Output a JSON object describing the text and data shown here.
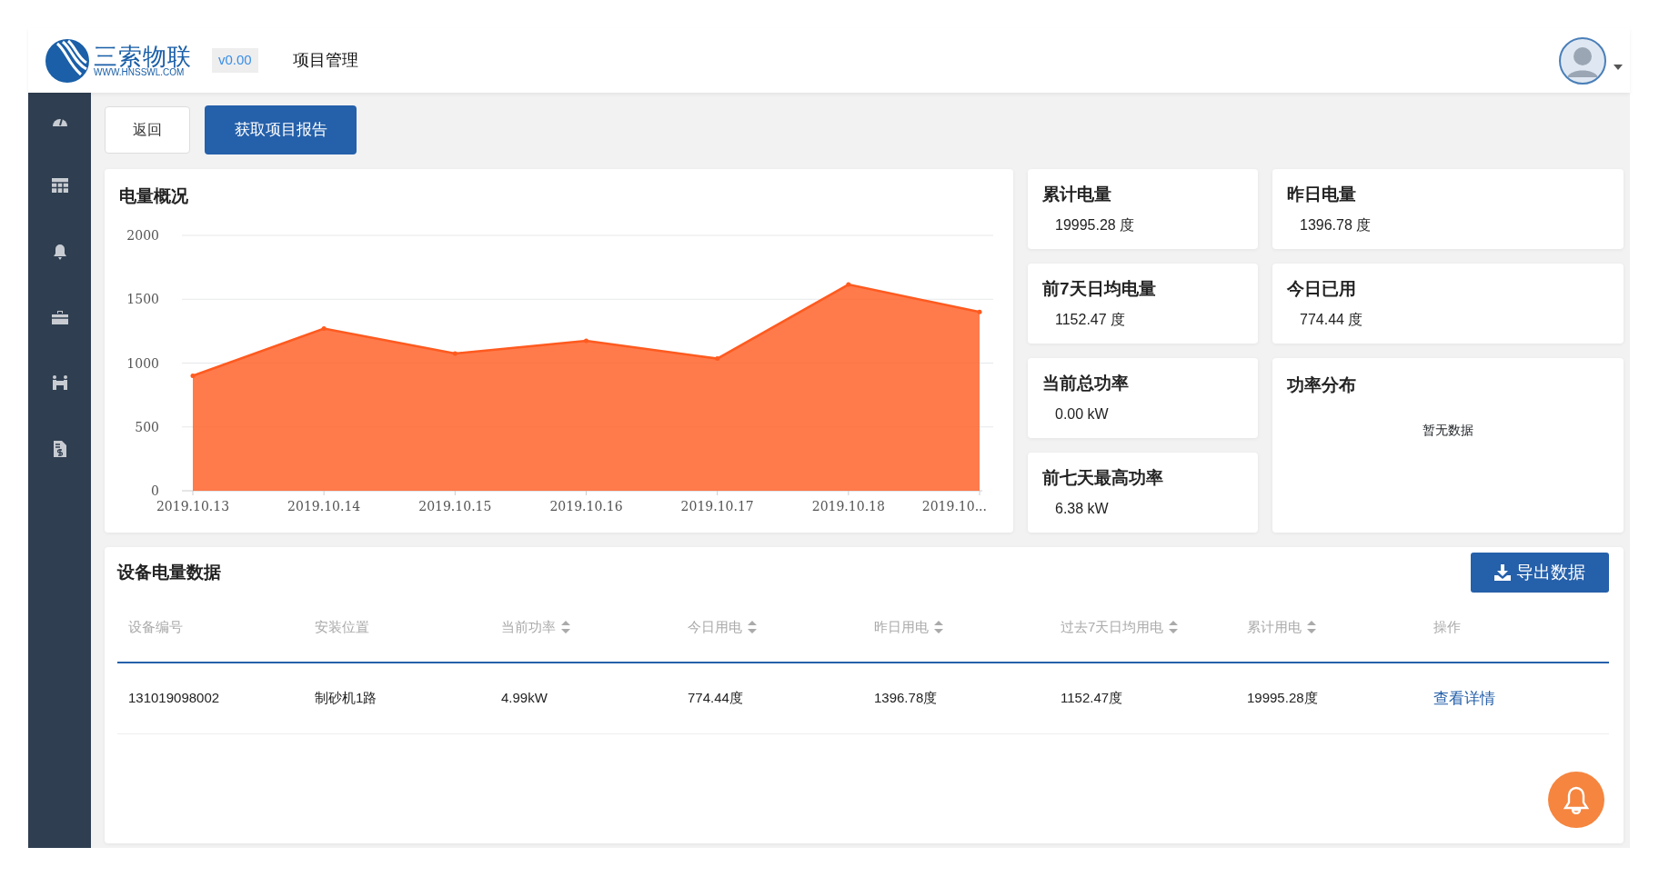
{
  "header": {
    "logo_title": "三索物联",
    "logo_url": "WWW.HNSSWL.COM",
    "version": "v0.00",
    "page_title": "项目管理"
  },
  "toolbar": {
    "buttons": [
      {
        "label": "返回",
        "kind": "outline"
      },
      {
        "label": "获取项目报告",
        "kind": "primary"
      }
    ]
  },
  "chart_panel": {
    "title": "电量概况",
    "chart_data": {
      "type": "area",
      "categories": [
        "2019.10.13",
        "2019.10.14",
        "2019.10.15",
        "2019.10.16",
        "2019.10.17",
        "2019.10.18",
        "2019.10..."
      ],
      "grid": true,
      "series": [
        {
          "color": "#ff5a1f",
          "values": [
            900,
            1270,
            1075,
            1175,
            1035,
            1615,
            1400
          ]
        }
      ],
      "ylim": [
        0,
        2000
      ],
      "yticks": [
        0,
        500,
        1000,
        1500,
        2000
      ]
    }
  },
  "stats": [
    {
      "title": "累计电量",
      "value": "19995.28 度"
    },
    {
      "title": "昨日电量",
      "value": "1396.78 度"
    },
    {
      "title": "前7天日均电量",
      "value": "1152.47 度"
    },
    {
      "title": "今日已用",
      "value": "774.44 度"
    },
    {
      "title": "当前总功率",
      "value": "0.00 kW"
    },
    {
      "title": "前七天最高功率",
      "value": "6.38 kW"
    }
  ],
  "power_distribution": {
    "title": "功率分布",
    "empty_text": "暂无数据"
  },
  "table": {
    "title": "设备电量数据",
    "export_button": "导出数据",
    "columns": [
      {
        "label": "设备编号",
        "sortable": false
      },
      {
        "label": "安装位置",
        "sortable": false
      },
      {
        "label": "当前功率",
        "sortable": true
      },
      {
        "label": "今日用电",
        "sortable": true
      },
      {
        "label": "昨日用电",
        "sortable": true
      },
      {
        "label": "过去7天日均用电",
        "sortable": true
      },
      {
        "label": "累计用电",
        "sortable": true
      },
      {
        "label": "操作",
        "sortable": false
      }
    ],
    "rows": [
      {
        "cells": [
          "131019098002",
          "制砂机1路",
          "4.99kW",
          "774.44度",
          "1396.78度",
          "1152.47度",
          "19995.28度"
        ],
        "action": "查看详情"
      }
    ]
  }
}
